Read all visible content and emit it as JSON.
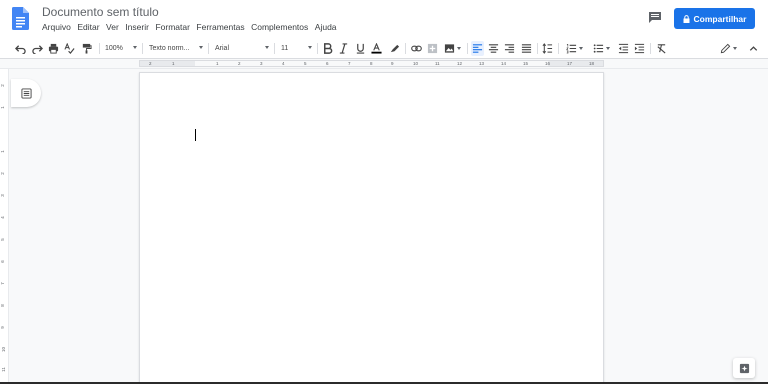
{
  "app": {
    "doc_title": "Documento sem título",
    "share_label": "Compartilhar"
  },
  "menu": [
    "Arquivo",
    "Editar",
    "Ver",
    "Inserir",
    "Formatar",
    "Ferramentas",
    "Complementos",
    "Ajuda"
  ],
  "toolbar": {
    "zoom": "100%",
    "style": "Texto norm...",
    "font": "Arial",
    "font_size": "11"
  },
  "ruler": {
    "marks": [
      "2",
      "1",
      "1",
      "2",
      "3",
      "4",
      "5",
      "6",
      "7",
      "8",
      "9",
      "10",
      "11",
      "12",
      "13",
      "14",
      "15",
      "16",
      "17",
      "18"
    ]
  },
  "vruler": {
    "marks": [
      "2",
      "1",
      "1",
      "2",
      "3",
      "4",
      "5",
      "6",
      "7",
      "8",
      "9",
      "10",
      "11"
    ]
  },
  "colors": {
    "accent": "#1a73e8",
    "doc_icon": "#4285f4"
  }
}
